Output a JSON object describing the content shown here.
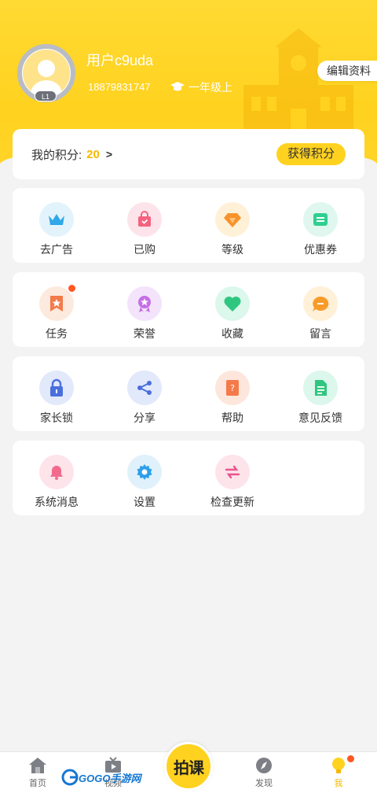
{
  "profile": {
    "username": "用户c9uda",
    "phone": "18879831747",
    "grade": "一年级上",
    "level": "L1",
    "edit_label": "编辑资料"
  },
  "points": {
    "label": "我的积分:",
    "value": "20",
    "arrow": ">",
    "earn_label": "获得积分"
  },
  "grid1": [
    {
      "label": "去广告",
      "icon": "crown-icon"
    },
    {
      "label": "已购",
      "icon": "shopping-bag-icon"
    },
    {
      "label": "等级",
      "icon": "diamond-icon"
    },
    {
      "label": "优惠券",
      "icon": "coupon-icon"
    }
  ],
  "grid2": [
    {
      "label": "任务",
      "icon": "task-star-icon"
    },
    {
      "label": "荣誉",
      "icon": "medal-icon"
    },
    {
      "label": "收藏",
      "icon": "heart-icon"
    },
    {
      "label": "留言",
      "icon": "message-icon"
    }
  ],
  "grid3": [
    {
      "label": "家长锁",
      "icon": "lock-icon"
    },
    {
      "label": "分享",
      "icon": "share-icon"
    },
    {
      "label": "帮助",
      "icon": "help-book-icon"
    },
    {
      "label": "意见反馈",
      "icon": "feedback-doc-icon"
    }
  ],
  "grid4": [
    {
      "label": "系统消息",
      "icon": "bell-icon"
    },
    {
      "label": "设置",
      "icon": "gear-icon"
    },
    {
      "label": "检查更新",
      "icon": "refresh-arrows-icon"
    }
  ],
  "tabbar": {
    "home": "首页",
    "video": "视频",
    "center": "拍课",
    "discover": "发现",
    "me": "我"
  },
  "watermark": "GOGO手游网",
  "colors": {
    "brand_yellow": "#ffd21f",
    "accent_red": "#ff5722",
    "points_orange": "#f5b800"
  }
}
